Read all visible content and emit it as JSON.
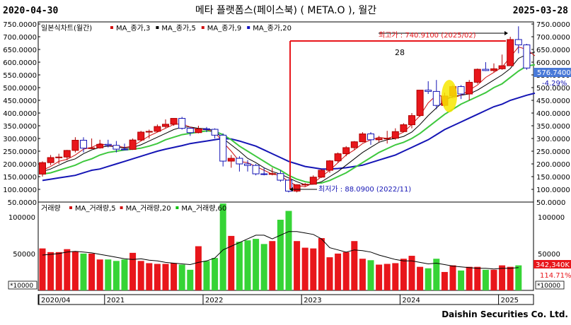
{
  "header": {
    "start_date": "2020-04-30",
    "title": "메타 플랫폼스(페이스북) ( META.O ), 월간",
    "end_date": "2025-03-28"
  },
  "price_legend": {
    "label": "일본식차트(월간)",
    "items": [
      {
        "text": "MA_종가,3",
        "color": "#d01010"
      },
      {
        "text": "MA_종가,5",
        "color": "#000000"
      },
      {
        "text": "MA_종가,9",
        "color": "#d01010"
      },
      {
        "text": "MA_종가,20",
        "color": "#1010c0"
      }
    ]
  },
  "volume_legend": {
    "label": "거래량",
    "items": [
      {
        "text": "MA_거래량,5",
        "color": "#d01010"
      },
      {
        "text": "MA_거래량,20",
        "color": "#d01010"
      },
      {
        "text": "MA_거래량,60",
        "color": "#10c010"
      }
    ]
  },
  "annotations": {
    "high": "최고가 : 740.9100 (2025/02)",
    "low": "최저가 : 88.0900 (2022/11)",
    "count": "28",
    "last_price": "576.7400",
    "change_pct": "-4.29%",
    "last_volume": "342,340K",
    "volume_ratio": "114.71%",
    "volume_unit": "*10000"
  },
  "footer": {
    "brand": "Daishin Securities Co. Ltd."
  },
  "colors": {
    "up": "#e8161b",
    "down": "#ffffff",
    "ma3": "#d01010",
    "ma5": "#000000",
    "ma9": "#3ec83e",
    "ma20": "#1515b5",
    "vol_up": "#e8161b",
    "vol_down": "#36d436"
  },
  "chart_data": {
    "type": "candlestick",
    "price_axis": {
      "min": 50,
      "max": 750,
      "ticks": [
        "750.0000",
        "700.0000",
        "650.0000",
        "600.0000",
        "550.0000",
        "500.0000",
        "450.0000",
        "400.0000",
        "350.0000",
        "300.0000",
        "250.0000",
        "200.0000",
        "150.0000",
        "100.0000",
        "50.0000"
      ]
    },
    "volume_axis": {
      "min": 0,
      "max": 120000,
      "ticks": [
        "100000",
        "50000"
      ]
    },
    "year_labels": [
      {
        "label": "2020/04",
        "index": 0
      },
      {
        "label": "2021",
        "index": 8
      },
      {
        "label": "2022",
        "index": 20
      },
      {
        "label": "2023",
        "index": 32
      },
      {
        "label": "2024",
        "index": 44
      },
      {
        "label": "2025",
        "index": 56
      }
    ],
    "candles": [
      {
        "d": "2020/04",
        "o": 160,
        "h": 210,
        "l": 150,
        "c": 205
      },
      {
        "d": "2020/05",
        "o": 205,
        "h": 235,
        "l": 195,
        "c": 225
      },
      {
        "d": "2020/06",
        "o": 225,
        "h": 240,
        "l": 200,
        "c": 227
      },
      {
        "d": "2020/07",
        "o": 227,
        "h": 255,
        "l": 215,
        "c": 253
      },
      {
        "d": "2020/08",
        "o": 253,
        "h": 305,
        "l": 245,
        "c": 293
      },
      {
        "d": "2020/09",
        "o": 293,
        "h": 305,
        "l": 245,
        "c": 262
      },
      {
        "d": "2020/10",
        "o": 262,
        "h": 300,
        "l": 258,
        "c": 263
      },
      {
        "d": "2020/11",
        "o": 263,
        "h": 295,
        "l": 260,
        "c": 277
      },
      {
        "d": "2020/12",
        "o": 277,
        "h": 295,
        "l": 265,
        "c": 273
      },
      {
        "d": "2021/01",
        "o": 273,
        "h": 290,
        "l": 245,
        "c": 258
      },
      {
        "d": "2021/02",
        "o": 258,
        "h": 280,
        "l": 255,
        "c": 257
      },
      {
        "d": "2021/03",
        "o": 257,
        "h": 300,
        "l": 255,
        "c": 294
      },
      {
        "d": "2021/04",
        "o": 294,
        "h": 330,
        "l": 290,
        "c": 325
      },
      {
        "d": "2021/05",
        "o": 325,
        "h": 335,
        "l": 300,
        "c": 328
      },
      {
        "d": "2021/06",
        "o": 328,
        "h": 355,
        "l": 325,
        "c": 347
      },
      {
        "d": "2021/07",
        "o": 347,
        "h": 375,
        "l": 340,
        "c": 356
      },
      {
        "d": "2021/08",
        "o": 356,
        "h": 380,
        "l": 350,
        "c": 379
      },
      {
        "d": "2021/09",
        "o": 379,
        "h": 385,
        "l": 335,
        "c": 340
      },
      {
        "d": "2021/10",
        "o": 340,
        "h": 345,
        "l": 310,
        "c": 323
      },
      {
        "d": "2021/11",
        "o": 323,
        "h": 350,
        "l": 320,
        "c": 338
      },
      {
        "d": "2021/12",
        "o": 338,
        "h": 345,
        "l": 325,
        "c": 336
      },
      {
        "d": "2022/01",
        "o": 336,
        "h": 340,
        "l": 300,
        "c": 313
      },
      {
        "d": "2022/02",
        "o": 313,
        "h": 320,
        "l": 190,
        "c": 211
      },
      {
        "d": "2022/03",
        "o": 211,
        "h": 235,
        "l": 185,
        "c": 222
      },
      {
        "d": "2022/04",
        "o": 222,
        "h": 230,
        "l": 170,
        "c": 200
      },
      {
        "d": "2022/05",
        "o": 200,
        "h": 215,
        "l": 170,
        "c": 194
      },
      {
        "d": "2022/06",
        "o": 194,
        "h": 200,
        "l": 155,
        "c": 161
      },
      {
        "d": "2022/07",
        "o": 161,
        "h": 185,
        "l": 155,
        "c": 159
      },
      {
        "d": "2022/08",
        "o": 159,
        "h": 185,
        "l": 155,
        "c": 162
      },
      {
        "d": "2022/09",
        "o": 162,
        "h": 175,
        "l": 130,
        "c": 136
      },
      {
        "d": "2022/10",
        "o": 136,
        "h": 140,
        "l": 88,
        "c": 93
      },
      {
        "d": "2022/11",
        "o": 93,
        "h": 120,
        "l": 88,
        "c": 118
      },
      {
        "d": "2022/12",
        "o": 118,
        "h": 125,
        "l": 110,
        "c": 120
      },
      {
        "d": "2023/01",
        "o": 120,
        "h": 155,
        "l": 120,
        "c": 148
      },
      {
        "d": "2023/02",
        "o": 148,
        "h": 180,
        "l": 145,
        "c": 175
      },
      {
        "d": "2023/03",
        "o": 175,
        "h": 215,
        "l": 165,
        "c": 212
      },
      {
        "d": "2023/04",
        "o": 212,
        "h": 245,
        "l": 205,
        "c": 240
      },
      {
        "d": "2023/05",
        "o": 240,
        "h": 270,
        "l": 230,
        "c": 264
      },
      {
        "d": "2023/06",
        "o": 264,
        "h": 290,
        "l": 255,
        "c": 287
      },
      {
        "d": "2023/07",
        "o": 287,
        "h": 325,
        "l": 285,
        "c": 318
      },
      {
        "d": "2023/08",
        "o": 318,
        "h": 325,
        "l": 275,
        "c": 295
      },
      {
        "d": "2023/09",
        "o": 295,
        "h": 310,
        "l": 285,
        "c": 300
      },
      {
        "d": "2023/10",
        "o": 300,
        "h": 330,
        "l": 280,
        "c": 301
      },
      {
        "d": "2023/11",
        "o": 301,
        "h": 340,
        "l": 295,
        "c": 327
      },
      {
        "d": "2023/12",
        "o": 327,
        "h": 360,
        "l": 325,
        "c": 354
      },
      {
        "d": "2024/01",
        "o": 354,
        "h": 400,
        "l": 340,
        "c": 390
      },
      {
        "d": "2024/02",
        "o": 390,
        "h": 490,
        "l": 385,
        "c": 490
      },
      {
        "d": "2024/03",
        "o": 490,
        "h": 525,
        "l": 475,
        "c": 485
      },
      {
        "d": "2024/04",
        "o": 485,
        "h": 530,
        "l": 415,
        "c": 430
      },
      {
        "d": "2024/05",
        "o": 430,
        "h": 480,
        "l": 425,
        "c": 467
      },
      {
        "d": "2024/06",
        "o": 467,
        "h": 510,
        "l": 465,
        "c": 504
      },
      {
        "d": "2024/07",
        "o": 504,
        "h": 510,
        "l": 455,
        "c": 475
      },
      {
        "d": "2024/08",
        "o": 475,
        "h": 530,
        "l": 450,
        "c": 521
      },
      {
        "d": "2024/09",
        "o": 521,
        "h": 575,
        "l": 515,
        "c": 572
      },
      {
        "d": "2024/10",
        "o": 572,
        "h": 600,
        "l": 565,
        "c": 567
      },
      {
        "d": "2024/11",
        "o": 567,
        "h": 595,
        "l": 560,
        "c": 574
      },
      {
        "d": "2024/12",
        "o": 574,
        "h": 630,
        "l": 570,
        "c": 586
      },
      {
        "d": "2025/01",
        "o": 586,
        "h": 700,
        "l": 585,
        "c": 689
      },
      {
        "d": "2025/02",
        "o": 689,
        "h": 741,
        "l": 635,
        "c": 668
      },
      {
        "d": "2025/03",
        "o": 668,
        "h": 672,
        "l": 570,
        "c": 577
      }
    ],
    "volumes": [
      57000,
      52000,
      52000,
      56000,
      53000,
      50000,
      50000,
      42000,
      42000,
      40000,
      42000,
      51000,
      40000,
      37000,
      36000,
      36000,
      37000,
      35000,
      28000,
      60000,
      40000,
      44000,
      118000,
      74000,
      66000,
      68000,
      70000,
      63000,
      67000,
      96000,
      108000,
      67000,
      58000,
      57000,
      71000,
      45000,
      50000,
      52000,
      67000,
      43000,
      41000,
      35000,
      36000,
      37000,
      43000,
      47000,
      32000,
      30000,
      43000,
      25000,
      34000,
      27000,
      32000,
      32000,
      28000,
      28000,
      34000,
      32000,
      34000
    ],
    "ma3": [
      175,
      190,
      210,
      218,
      235,
      258,
      265,
      280,
      272,
      270,
      265,
      270,
      290,
      310,
      325,
      340,
      355,
      358,
      345,
      333,
      335,
      325,
      285,
      250,
      210,
      205,
      190,
      175,
      160,
      155,
      130,
      115,
      110,
      125,
      150,
      175,
      205,
      235,
      255,
      280,
      295,
      305,
      300,
      310,
      325,
      355,
      390,
      440,
      470,
      465,
      460,
      470,
      490,
      510,
      540,
      560,
      580,
      620,
      660,
      650,
      625
    ],
    "ma5": [
      170,
      180,
      195,
      210,
      220,
      240,
      255,
      265,
      270,
      268,
      262,
      265,
      275,
      290,
      305,
      320,
      335,
      345,
      345,
      340,
      338,
      330,
      300,
      275,
      250,
      222,
      205,
      185,
      170,
      160,
      145,
      130,
      118,
      120,
      130,
      150,
      170,
      195,
      220,
      245,
      265,
      285,
      295,
      300,
      308,
      325,
      355,
      390,
      420,
      450,
      465,
      470,
      475,
      490,
      510,
      530,
      550,
      575,
      615,
      630,
      640
    ],
    "ma9": [
      160,
      165,
      175,
      185,
      195,
      210,
      220,
      235,
      245,
      250,
      255,
      258,
      262,
      270,
      280,
      295,
      305,
      315,
      320,
      325,
      330,
      328,
      315,
      295,
      270,
      250,
      230,
      210,
      190,
      175,
      155,
      140,
      130,
      125,
      125,
      135,
      150,
      165,
      185,
      205,
      225,
      245,
      260,
      275,
      285,
      300,
      320,
      345,
      370,
      395,
      415,
      435,
      450,
      465,
      480,
      500,
      515,
      540,
      565,
      585,
      590
    ],
    "ma20": [
      135,
      140,
      145,
      150,
      155,
      165,
      175,
      180,
      190,
      200,
      210,
      220,
      230,
      240,
      250,
      258,
      265,
      272,
      280,
      285,
      290,
      295,
      300,
      298,
      290,
      280,
      270,
      255,
      240,
      225,
      210,
      200,
      190,
      185,
      180,
      180,
      182,
      185,
      190,
      195,
      205,
      215,
      225,
      235,
      250,
      265,
      280,
      295,
      315,
      335,
      350,
      365,
      380,
      395,
      410,
      425,
      435,
      450,
      460,
      470,
      478
    ],
    "vol_ma5": [
      48000,
      49000,
      50000,
      52000,
      53000,
      52000,
      51000,
      49000,
      47000,
      45000,
      43000,
      42000,
      43000,
      41000,
      40000,
      38000,
      37000,
      36000,
      35000,
      38000,
      40000,
      44000,
      55000,
      60000,
      65000,
      70000,
      75000,
      75000,
      70000,
      75000,
      80000,
      80000,
      78000,
      76000,
      70000,
      58000,
      55000,
      52000,
      55000,
      54000,
      52000,
      48000,
      45000,
      42000,
      40000,
      40000,
      38000,
      36000,
      37000,
      35000,
      33000,
      32000,
      31000,
      30000,
      30000,
      29000,
      30000,
      30000,
      31000
    ]
  }
}
